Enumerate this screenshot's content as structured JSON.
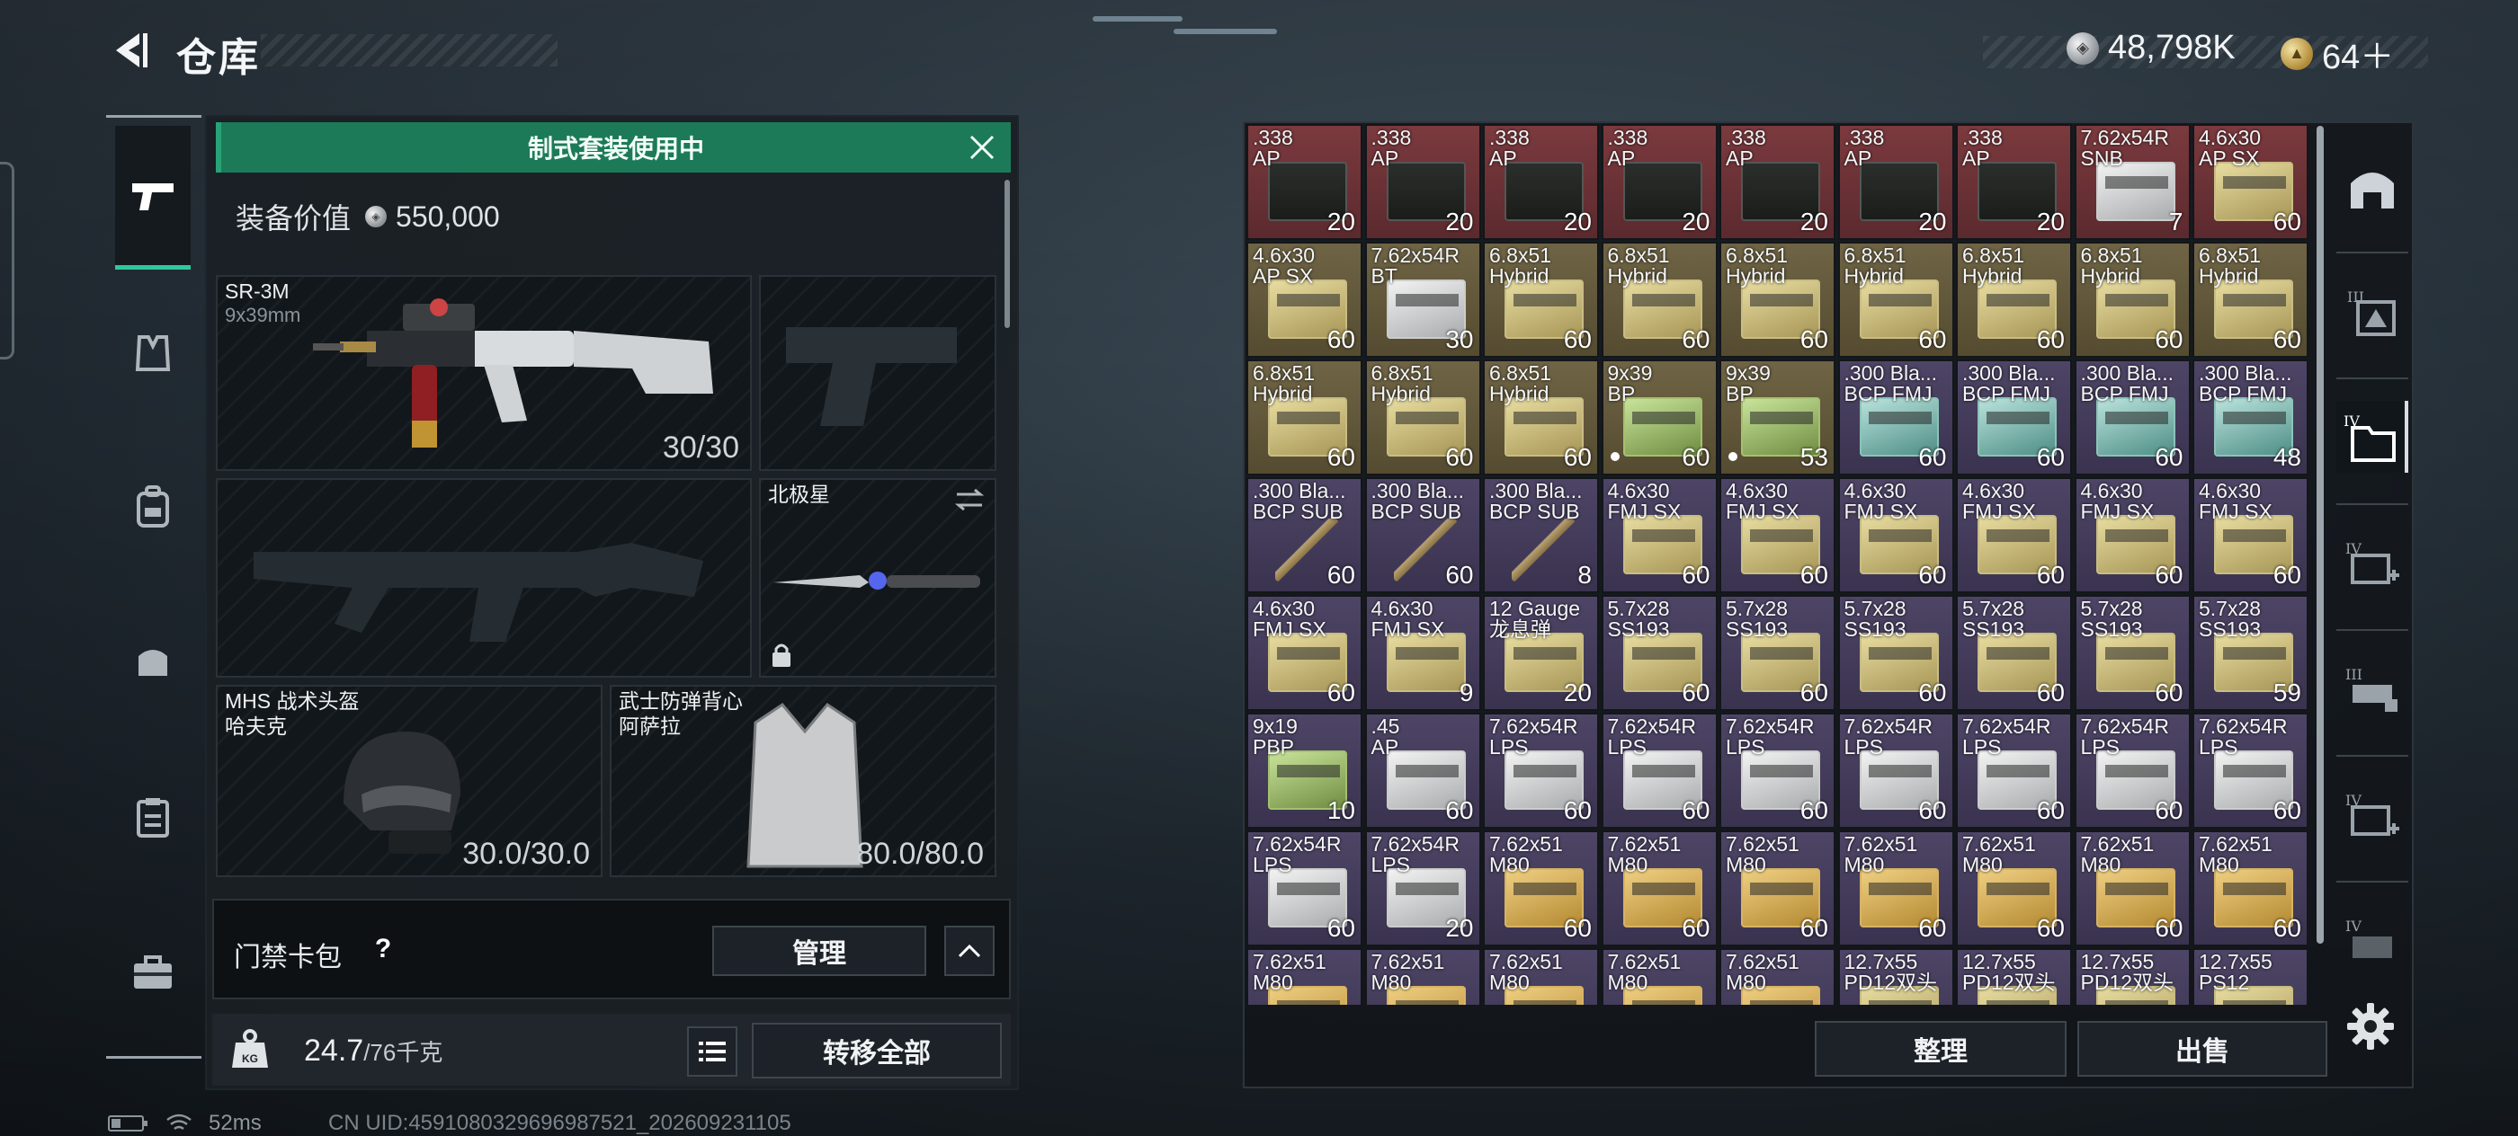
{
  "header": {
    "title": "仓库",
    "currency_silver": "48,798K",
    "currency_gold": "64＋"
  },
  "loadout": {
    "banner_text": "制式套装使用中",
    "equip_value_label": "装备价值",
    "equip_value": "550,000",
    "primary": {
      "name": "SR-3M",
      "caliber": "9x39mm",
      "ammo": "30/30"
    },
    "melee": {
      "name": "北极星"
    },
    "helmet": {
      "name": "MHS 战术头盔",
      "sub": "哈夫克",
      "durability": "30.0/30.0"
    },
    "armor": {
      "name": "武士防弹背心",
      "sub": "阿萨拉",
      "durability": "80.0/80.0"
    },
    "cardpack_label": "门禁卡包",
    "manage_label": "管理",
    "weight_value": "24.7",
    "weight_max": "/76千克",
    "transfer_label": "转移全部"
  },
  "status": {
    "ping": "52ms",
    "uid": "CN UID:4591080329696987521_202609231105"
  },
  "stash": {
    "sort_label": "整理",
    "sell_label": "出售",
    "items": [
      {
        "name": ".338\nAP",
        "count": "20",
        "tone": "red",
        "box": "ammo-can"
      },
      {
        "name": ".338\nAP",
        "count": "20",
        "tone": "red",
        "box": "ammo-can"
      },
      {
        "name": ".338\nAP",
        "count": "20",
        "tone": "red",
        "box": "ammo-can"
      },
      {
        "name": ".338\nAP",
        "count": "20",
        "tone": "red",
        "box": "ammo-can"
      },
      {
        "name": ".338\nAP",
        "count": "20",
        "tone": "red",
        "box": "ammo-can"
      },
      {
        "name": ".338\nAP",
        "count": "20",
        "tone": "red",
        "box": "ammo-can"
      },
      {
        "name": ".338\nAP",
        "count": "20",
        "tone": "red",
        "box": "ammo-can"
      },
      {
        "name": "7.62x54R\nSNB",
        "count": "7",
        "tone": "red",
        "box": "box-white"
      },
      {
        "name": "4.6x30\nAP SX",
        "count": "60",
        "tone": "red",
        "box": "box-yellow"
      },
      {
        "name": "4.6x30\nAP SX",
        "count": "60",
        "tone": "gold",
        "box": "box-yellow"
      },
      {
        "name": "7.62x54R\nBT",
        "count": "30",
        "tone": "gold",
        "box": "box-white"
      },
      {
        "name": "6.8x51\nHybrid",
        "count": "60",
        "tone": "gold",
        "box": "box-yellow"
      },
      {
        "name": "6.8x51\nHybrid",
        "count": "60",
        "tone": "gold",
        "box": "box-yellow"
      },
      {
        "name": "6.8x51\nHybrid",
        "count": "60",
        "tone": "gold",
        "box": "box-yellow"
      },
      {
        "name": "6.8x51\nHybrid",
        "count": "60",
        "tone": "gold",
        "box": "box-yellow"
      },
      {
        "name": "6.8x51\nHybrid",
        "count": "60",
        "tone": "gold",
        "box": "box-yellow"
      },
      {
        "name": "6.8x51\nHybrid",
        "count": "60",
        "tone": "gold",
        "box": "box-yellow"
      },
      {
        "name": "6.8x51\nHybrid",
        "count": "60",
        "tone": "gold",
        "box": "box-yellow"
      },
      {
        "name": "6.8x51\nHybrid",
        "count": "60",
        "tone": "gold",
        "box": "box-yellow"
      },
      {
        "name": "6.8x51\nHybrid",
        "count": "60",
        "tone": "gold",
        "box": "box-yellow"
      },
      {
        "name": "6.8x51\nHybrid",
        "count": "60",
        "tone": "gold",
        "box": "box-yellow"
      },
      {
        "name": "9x39\nBP",
        "count": "60",
        "tone": "gold",
        "box": "box-green",
        "dot": true
      },
      {
        "name": "9x39\nBP",
        "count": "53",
        "tone": "gold",
        "box": "box-green",
        "dot": true
      },
      {
        "name": ".300 Bla...\nBCP FMJ",
        "count": "60",
        "tone": "purple",
        "box": "box-teal"
      },
      {
        "name": ".300 Bla...\nBCP FMJ",
        "count": "60",
        "tone": "purple",
        "box": "box-teal"
      },
      {
        "name": ".300 Bla...\nBCP FMJ",
        "count": "60",
        "tone": "purple",
        "box": "box-teal"
      },
      {
        "name": ".300 Bla...\nBCP FMJ",
        "count": "48",
        "tone": "purple",
        "box": "box-teal"
      },
      {
        "name": ".300 Bla...\nBCP SUB",
        "count": "60",
        "tone": "purple",
        "box": "cartridge"
      },
      {
        "name": ".300 Bla...\nBCP SUB",
        "count": "60",
        "tone": "purple",
        "box": "cartridge"
      },
      {
        "name": ".300 Bla...\nBCP SUB",
        "count": "8",
        "tone": "purple",
        "box": "cartridge"
      },
      {
        "name": "4.6x30\nFMJ SX",
        "count": "60",
        "tone": "purple",
        "box": "box-yellow"
      },
      {
        "name": "4.6x30\nFMJ SX",
        "count": "60",
        "tone": "purple",
        "box": "box-yellow"
      },
      {
        "name": "4.6x30\nFMJ SX",
        "count": "60",
        "tone": "purple",
        "box": "box-yellow"
      },
      {
        "name": "4.6x30\nFMJ SX",
        "count": "60",
        "tone": "purple",
        "box": "box-yellow"
      },
      {
        "name": "4.6x30\nFMJ SX",
        "count": "60",
        "tone": "purple",
        "box": "box-yellow"
      },
      {
        "name": "4.6x30\nFMJ SX",
        "count": "60",
        "tone": "purple",
        "box": "box-yellow"
      },
      {
        "name": "4.6x30\nFMJ SX",
        "count": "60",
        "tone": "purple",
        "box": "box-yellow"
      },
      {
        "name": "4.6x30\nFMJ SX",
        "count": "9",
        "tone": "purple",
        "box": "box-yellow"
      },
      {
        "name": "12 Gauge\n龙息弹",
        "count": "20",
        "tone": "purple",
        "box": "box-yellow"
      },
      {
        "name": "5.7x28\nSS193",
        "count": "60",
        "tone": "purple",
        "box": "box-yellow"
      },
      {
        "name": "5.7x28\nSS193",
        "count": "60",
        "tone": "purple",
        "box": "box-yellow"
      },
      {
        "name": "5.7x28\nSS193",
        "count": "60",
        "tone": "purple",
        "box": "box-yellow"
      },
      {
        "name": "5.7x28\nSS193",
        "count": "60",
        "tone": "purple",
        "box": "box-yellow"
      },
      {
        "name": "5.7x28\nSS193",
        "count": "60",
        "tone": "purple",
        "box": "box-yellow"
      },
      {
        "name": "5.7x28\nSS193",
        "count": "59",
        "tone": "purple",
        "box": "box-yellow"
      },
      {
        "name": "9x19\nPBP",
        "count": "10",
        "tone": "purple",
        "box": "box-green"
      },
      {
        "name": ".45\nAP",
        "count": "60",
        "tone": "purple",
        "box": "box-white"
      },
      {
        "name": "7.62x54R\nLPS",
        "count": "60",
        "tone": "purple",
        "box": "box-white"
      },
      {
        "name": "7.62x54R\nLPS",
        "count": "60",
        "tone": "purple",
        "box": "box-white"
      },
      {
        "name": "7.62x54R\nLPS",
        "count": "60",
        "tone": "purple",
        "box": "box-white"
      },
      {
        "name": "7.62x54R\nLPS",
        "count": "60",
        "tone": "purple",
        "box": "box-white"
      },
      {
        "name": "7.62x54R\nLPS",
        "count": "60",
        "tone": "purple",
        "box": "box-white"
      },
      {
        "name": "7.62x54R\nLPS",
        "count": "60",
        "tone": "purple",
        "box": "box-white"
      },
      {
        "name": "7.62x54R\nLPS",
        "count": "60",
        "tone": "purple",
        "box": "box-white"
      },
      {
        "name": "7.62x54R\nLPS",
        "count": "60",
        "tone": "purple",
        "box": "box-white"
      },
      {
        "name": "7.62x54R\nLPS",
        "count": "20",
        "tone": "purple",
        "box": "box-white"
      },
      {
        "name": "7.62x51\nM80",
        "count": "60",
        "tone": "purple",
        "box": "box-orange"
      },
      {
        "name": "7.62x51\nM80",
        "count": "60",
        "tone": "purple",
        "box": "box-orange"
      },
      {
        "name": "7.62x51\nM80",
        "count": "60",
        "tone": "purple",
        "box": "box-orange"
      },
      {
        "name": "7.62x51\nM80",
        "count": "60",
        "tone": "purple",
        "box": "box-orange"
      },
      {
        "name": "7.62x51\nM80",
        "count": "60",
        "tone": "purple",
        "box": "box-orange"
      },
      {
        "name": "7.62x51\nM80",
        "count": "60",
        "tone": "purple",
        "box": "box-orange"
      },
      {
        "name": "7.62x51\nM80",
        "count": "60",
        "tone": "purple",
        "box": "box-orange"
      },
      {
        "name": "7.62x51\nM80",
        "count": "",
        "tone": "purple",
        "box": "box-orange"
      },
      {
        "name": "7.62x51\nM80",
        "count": "",
        "tone": "purple",
        "box": "box-orange"
      },
      {
        "name": "7.62x51\nM80",
        "count": "",
        "tone": "purple",
        "box": "box-orange"
      },
      {
        "name": "7.62x51\nM80",
        "count": "",
        "tone": "purple",
        "box": "box-orange"
      },
      {
        "name": "7.62x51\nM80",
        "count": "",
        "tone": "purple",
        "box": "box-orange"
      },
      {
        "name": "12.7x55\nPD12双头",
        "count": "",
        "tone": "purple",
        "box": "box-yellow"
      },
      {
        "name": "12.7x55\nPD12双头",
        "count": "",
        "tone": "purple",
        "box": "box-yellow"
      },
      {
        "name": "12.7x55\nPD12双头",
        "count": "",
        "tone": "purple",
        "box": "box-yellow"
      },
      {
        "name": "12.7x55\nPS12",
        "count": "",
        "tone": "purple",
        "box": "box-yellow"
      }
    ]
  },
  "icons": {
    "rail_left": [
      "pistol-icon",
      "vest-icon",
      "backpack-icon",
      "bag-icon",
      "clipboard-icon",
      "toolbox-icon"
    ],
    "rail_right": [
      "arch-icon",
      "case-3-icon",
      "folder-4-icon",
      "medkit-4-icon",
      "tag-3-icon",
      "medkit-4-alt-icon",
      "case-4-icon"
    ]
  }
}
